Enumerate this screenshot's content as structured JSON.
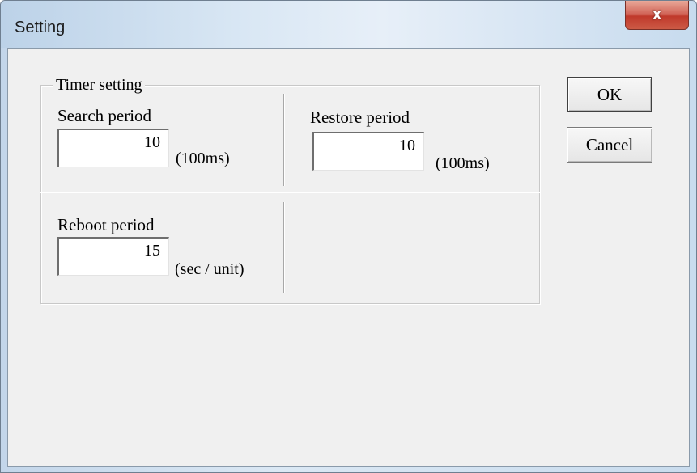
{
  "window": {
    "title": "Setting",
    "close_glyph": "x"
  },
  "timer_group": {
    "legend": "Timer setting",
    "search": {
      "label": "Search period",
      "value": "10",
      "unit": "(100ms)"
    },
    "restore": {
      "label": "Restore period",
      "value": "10",
      "unit": "(100ms)"
    },
    "reboot": {
      "label": "Reboot period",
      "value": "15",
      "unit": "(sec / unit)"
    }
  },
  "buttons": {
    "ok_label": "OK",
    "cancel_label": "Cancel"
  },
  "colors": {
    "dialog_background": "#f0f0f0",
    "close_button": "#c0392b",
    "title_bar": "#d9e7f4"
  },
  "icons": {
    "close": "close-icon"
  }
}
